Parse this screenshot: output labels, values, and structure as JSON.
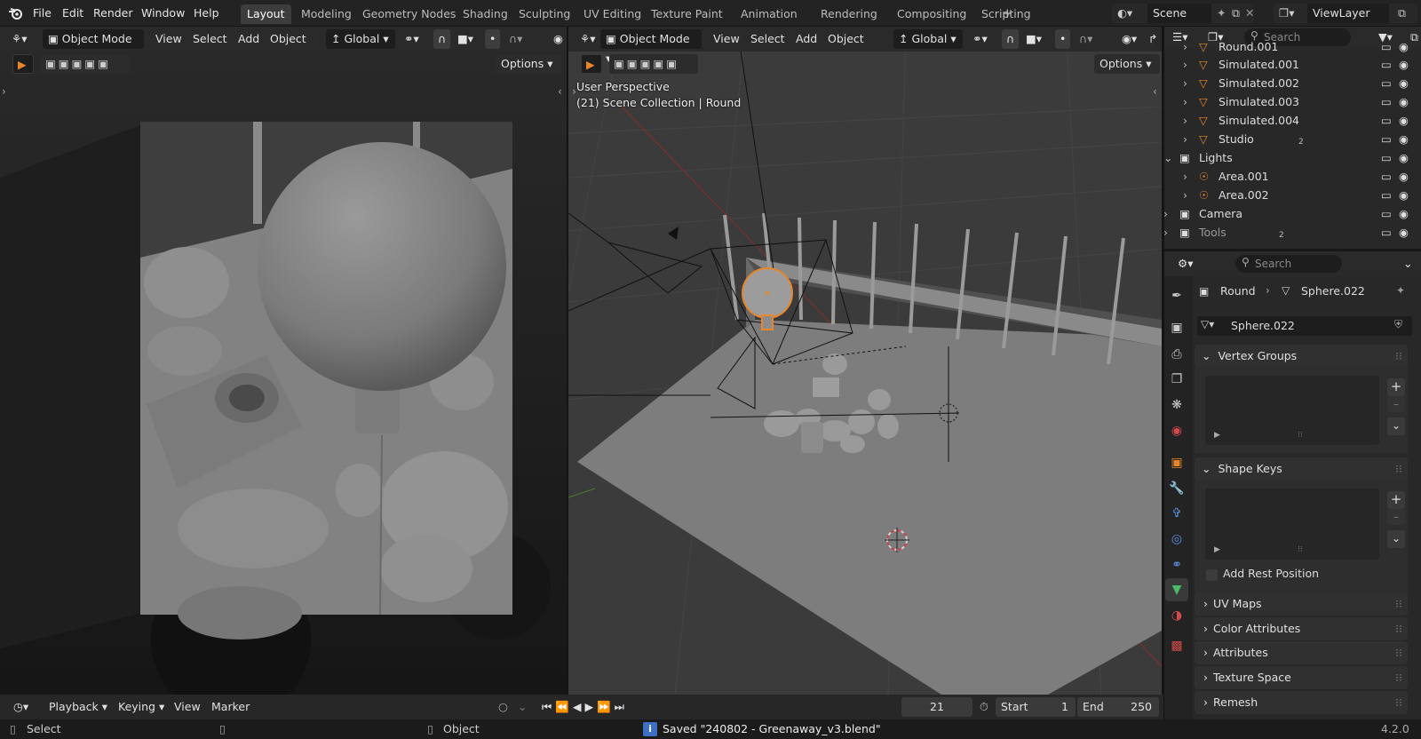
{
  "menu": [
    "File",
    "Edit",
    "Render",
    "Window",
    "Help"
  ],
  "workspaces": [
    "Layout",
    "Modeling",
    "Geometry Nodes",
    "Shading",
    "Sculpting",
    "UV Editing",
    "Texture Paint",
    "Animation",
    "Rendering",
    "Compositing",
    "Scripting"
  ],
  "active_workspace": "Layout",
  "add_workspace_icon": "+",
  "scene_name": "Scene",
  "view_layer": "ViewLayer",
  "left_viewport": {
    "mode": "Object Mode",
    "menus": [
      "View",
      "Select",
      "Add",
      "Object"
    ],
    "orientation": "Global",
    "options_label": "Options"
  },
  "right_viewport": {
    "mode": "Object Mode",
    "menus": [
      "View",
      "Select",
      "Add",
      "Object"
    ],
    "orientation": "Global",
    "options_label": "Options",
    "overlay_line1": "User Perspective",
    "overlay_line2": "(21) Scene Collection | Round"
  },
  "outliner": {
    "search_placeholder": "Search",
    "rows": [
      {
        "name": "Round.001",
        "type": "mesh",
        "indent": 2
      },
      {
        "name": "Simulated.001",
        "type": "mesh",
        "indent": 2
      },
      {
        "name": "Simulated.002",
        "type": "mesh",
        "indent": 2
      },
      {
        "name": "Simulated.003",
        "type": "mesh",
        "indent": 2
      },
      {
        "name": "Simulated.004",
        "type": "mesh",
        "indent": 2
      },
      {
        "name": "Studio",
        "type": "mesh",
        "indent": 2,
        "badge": "2"
      },
      {
        "name": "Lights",
        "type": "collection",
        "indent": 1
      },
      {
        "name": "Area.001",
        "type": "light",
        "indent": 2
      },
      {
        "name": "Area.002",
        "type": "light",
        "indent": 2
      },
      {
        "name": "Camera",
        "type": "collection",
        "indent": 1
      },
      {
        "name": "Tools",
        "type": "collection",
        "indent": 1,
        "badge": "2"
      }
    ]
  },
  "properties": {
    "search_placeholder": "Search",
    "breadcrumb_object": "Round",
    "breadcrumb_data": "Sphere.022",
    "data_name": "Sphere.022",
    "panels": {
      "vertex_groups": "Vertex Groups",
      "shape_keys": "Shape Keys",
      "add_rest_position": "Add Rest Position",
      "uv_maps": "UV Maps",
      "color_attributes": "Color Attributes",
      "attributes": "Attributes",
      "texture_space": "Texture Space",
      "remesh": "Remesh"
    }
  },
  "timeline": {
    "menus": [
      "Playback",
      "Keying",
      "View",
      "Marker"
    ],
    "current_frame": "21",
    "start_label": "Start",
    "start": "1",
    "end_label": "End",
    "end": "250"
  },
  "status": {
    "select": "Select",
    "object": "Object",
    "message": "Saved \"240802 - Greenaway_v3.blend\"",
    "version": "4.2.0"
  },
  "colors": {
    "accent_orange": "#e8872a",
    "selection_blue": "#4772b3",
    "active_tab": "#3d3d3d"
  }
}
